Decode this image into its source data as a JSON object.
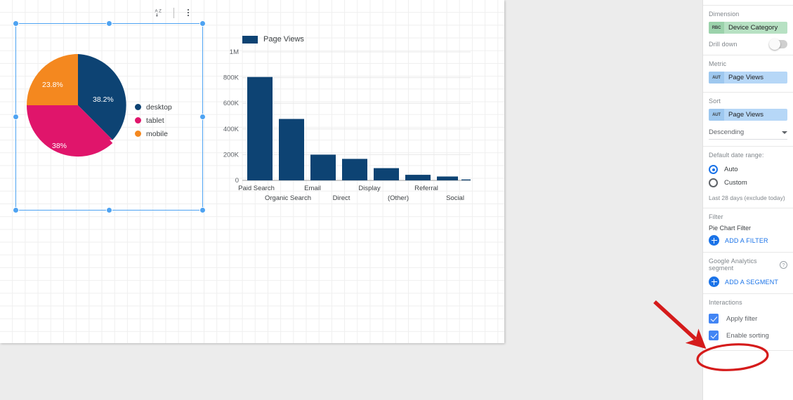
{
  "canvas": {
    "toolbar": {
      "sort_icon": "sort-az-icon",
      "more_icon": "more-vert-icon"
    }
  },
  "pie_widget": {
    "selected": true,
    "legend": [
      {
        "label": "desktop",
        "color": "#0d4373"
      },
      {
        "label": "tablet",
        "color": "#e0156b"
      },
      {
        "label": "mobile",
        "color": "#f4881f"
      }
    ]
  },
  "bar_widget": {
    "legend_label": "Page Views",
    "legend_color": "#0d4373"
  },
  "panel": {
    "dimension": {
      "title": "Dimension",
      "chip_type": "RBC",
      "chip_name": "Device Category"
    },
    "drill_down": {
      "label": "Drill down",
      "enabled": false
    },
    "metric": {
      "title": "Metric",
      "chip_type": "AUT",
      "chip_name": "Page Views"
    },
    "sort": {
      "title": "Sort",
      "chip_type": "AUT",
      "chip_name": "Page Views",
      "direction": "Descending"
    },
    "date_range": {
      "title": "Default date range:",
      "auto_label": "Auto",
      "custom_label": "Custom",
      "selected": "Auto",
      "hint": "Last 28 days (exclude today)"
    },
    "filter": {
      "title": "Filter",
      "existing_filter": "Pie Chart Filter",
      "add_label": "ADD A FILTER"
    },
    "segment": {
      "title": "Google Analytics segment",
      "help": "?",
      "add_label": "ADD A SEGMENT"
    },
    "interactions": {
      "title": "Interactions",
      "items": [
        {
          "label": "Apply filter",
          "checked": true
        },
        {
          "label": "Enable sorting",
          "checked": true
        }
      ]
    }
  },
  "annotation": {
    "color": "#d51b1b",
    "highlights": [
      "arrow-pointing-to-apply-filter",
      "ellipse-around-apply-filter"
    ]
  },
  "chart_data": [
    {
      "type": "pie",
      "title": "",
      "labels": [
        "desktop",
        "tablet",
        "mobile"
      ],
      "values": [
        38.2,
        38.0,
        23.8
      ],
      "value_labels": [
        "38.2%",
        "38%",
        "23.8%"
      ],
      "colors": [
        "#0d4373",
        "#e0156b",
        "#f4881f"
      ],
      "legend": "right",
      "unit": "percent"
    },
    {
      "type": "bar",
      "title": "",
      "series": [
        {
          "name": "Page Views",
          "color": "#0d4373",
          "values": [
            805000,
            478000,
            200000,
            167000,
            95000,
            43000,
            30000,
            7000
          ]
        }
      ],
      "categories": [
        "Paid Search",
        "Organic Search",
        "Email",
        "Direct",
        "Display",
        "(Other)",
        "Referral",
        "Social"
      ],
      "xlabel": "",
      "ylabel": "",
      "ylim": [
        0,
        1000000
      ],
      "yticks": [
        0,
        200000,
        400000,
        600000,
        800000,
        1000000
      ],
      "ytick_labels": [
        "0",
        "200K",
        "400K",
        "600K",
        "800K",
        "1M"
      ],
      "grid": true,
      "legend": "top-left"
    }
  ]
}
